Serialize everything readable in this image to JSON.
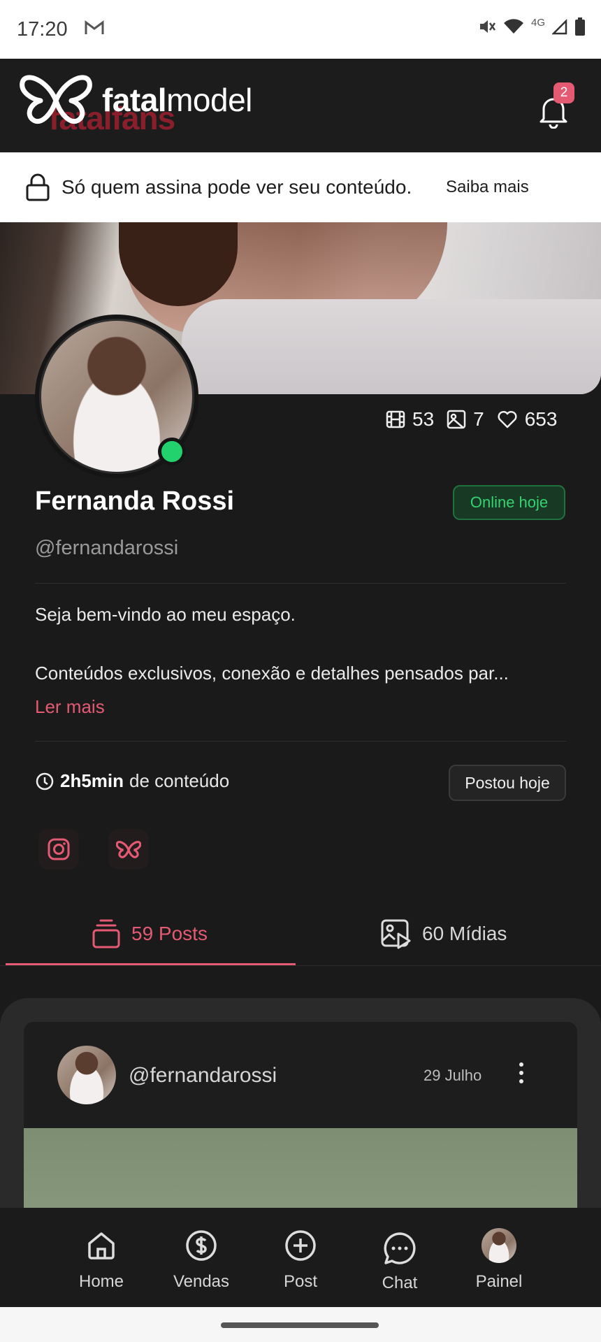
{
  "status_bar": {
    "time": "17:20",
    "network": "4G"
  },
  "header": {
    "brand_bold": "fatal",
    "brand_regular": "model",
    "brand_ghost": "fatalfans",
    "notification_count": "2"
  },
  "banner": {
    "message": "Só quem assina pode ver seu conteúdo.",
    "link": "Saiba mais"
  },
  "profile": {
    "name": "Fernanda Rossi",
    "handle": "@fernandarossi",
    "online_badge": "Online hoje",
    "stats": {
      "videos": "53",
      "photos": "7",
      "likes": "653"
    },
    "bio_line1": "Seja bem-vindo ao meu espaço.",
    "bio_line2": "Conteúdos exclusivos, conexão e detalhes pensados par...",
    "read_more": "Ler mais",
    "duration_value": "2h5min",
    "duration_suffix": "de conteúdo",
    "posted_badge": "Postou hoje"
  },
  "tabs": [
    {
      "label": "59 Posts",
      "active": true
    },
    {
      "label": "60 Mídias",
      "active": false
    }
  ],
  "post": {
    "handle": "@fernandarossi",
    "date": "29 Julho"
  },
  "bottom_nav": [
    {
      "label": "Home",
      "icon": "home-icon"
    },
    {
      "label": "Vendas",
      "icon": "dollar-icon"
    },
    {
      "label": "Post",
      "icon": "plus-circle-icon"
    },
    {
      "label": "Chat",
      "icon": "chat-icon"
    },
    {
      "label": "Painel",
      "icon": "avatar"
    }
  ],
  "colors": {
    "accent": "#e35a72",
    "online": "#22d36d",
    "background": "#1a1a1a"
  }
}
